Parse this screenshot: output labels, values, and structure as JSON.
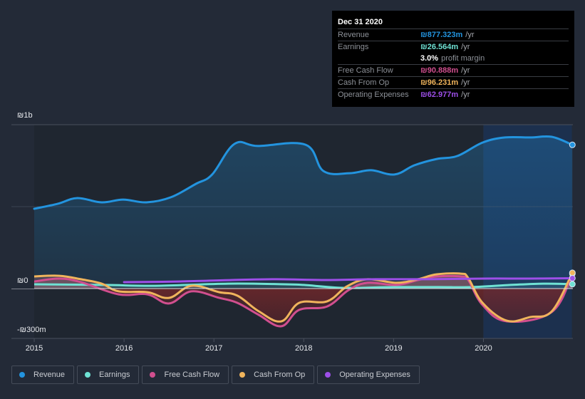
{
  "tooltip": {
    "date": "Dec 31 2020",
    "rows": [
      {
        "label": "Revenue",
        "value": "₪877.323m",
        "unit": "/yr",
        "color": "#2394df"
      },
      {
        "label": "Earnings",
        "value": "₪26.564m",
        "unit": "/yr",
        "color": "#6fe2d4"
      },
      {
        "label": "",
        "value": "3.0%",
        "unit": "profit margin",
        "color": "#ffffff"
      },
      {
        "label": "Free Cash Flow",
        "value": "₪90.888m",
        "unit": "/yr",
        "color": "#d14f8f"
      },
      {
        "label": "Cash From Op",
        "value": "₪96.231m",
        "unit": "/yr",
        "color": "#f0b45c"
      },
      {
        "label": "Operating Expenses",
        "value": "₪62.977m",
        "unit": "/yr",
        "color": "#9d4fe8"
      }
    ]
  },
  "legend": [
    {
      "label": "Revenue",
      "color": "#2394df"
    },
    {
      "label": "Earnings",
      "color": "#6fe2d4"
    },
    {
      "label": "Free Cash Flow",
      "color": "#d14f8f"
    },
    {
      "label": "Cash From Op",
      "color": "#f0b45c"
    },
    {
      "label": "Operating Expenses",
      "color": "#9d4fe8"
    }
  ],
  "chart_data": {
    "type": "line",
    "title": "",
    "xlabel": "",
    "ylabel": "",
    "currency": "₪",
    "ylim": [
      -300,
      1000
    ],
    "xlim": [
      2015.0,
      2021.0
    ],
    "y_ticks": [
      {
        "value": 1000,
        "label": "₪1b"
      },
      {
        "value": 0,
        "label": "₪0"
      },
      {
        "value": -300,
        "label": "-₪300m"
      }
    ],
    "x_ticks": [
      {
        "value": 2015,
        "label": "2015"
      },
      {
        "value": 2016,
        "label": "2016"
      },
      {
        "value": 2017,
        "label": "2017"
      },
      {
        "value": 2018,
        "label": "2018"
      },
      {
        "value": 2019,
        "label": "2019"
      },
      {
        "value": 2020,
        "label": "2020"
      }
    ],
    "forecast_shade_from": 2020.0,
    "units": "millions",
    "series": [
      {
        "name": "Revenue",
        "color": "#2394df",
        "fill": true,
        "points": [
          [
            2015.0,
            487
          ],
          [
            2015.26,
            517
          ],
          [
            2015.48,
            552
          ],
          [
            2015.75,
            526
          ],
          [
            2015.99,
            543
          ],
          [
            2016.25,
            526
          ],
          [
            2016.52,
            557
          ],
          [
            2016.8,
            639
          ],
          [
            2016.98,
            696
          ],
          [
            2017.23,
            883
          ],
          [
            2017.49,
            870
          ],
          [
            2018.02,
            878
          ],
          [
            2018.22,
            717
          ],
          [
            2018.51,
            704
          ],
          [
            2018.75,
            722
          ],
          [
            2019.01,
            696
          ],
          [
            2019.23,
            752
          ],
          [
            2019.48,
            791
          ],
          [
            2019.71,
            809
          ],
          [
            2019.99,
            891
          ],
          [
            2020.24,
            922
          ],
          [
            2020.52,
            922
          ],
          [
            2020.76,
            926
          ],
          [
            2020.99,
            877
          ]
        ]
      },
      {
        "name": "Earnings",
        "color": "#6fe2d4",
        "fill": true,
        "points": [
          [
            2015.0,
            26
          ],
          [
            2015.78,
            22
          ],
          [
            2016.35,
            17
          ],
          [
            2017.16,
            30
          ],
          [
            2017.79,
            26
          ],
          [
            2018.0,
            22
          ],
          [
            2018.46,
            4
          ],
          [
            2019.0,
            9
          ],
          [
            2019.5,
            9
          ],
          [
            2019.87,
            9
          ],
          [
            2020.3,
            22
          ],
          [
            2020.67,
            30
          ],
          [
            2020.99,
            27
          ]
        ]
      },
      {
        "name": "Free Cash Flow",
        "color": "#d14f8f",
        "fill": true,
        "points": [
          [
            2015.0,
            43
          ],
          [
            2015.28,
            61
          ],
          [
            2015.52,
            39
          ],
          [
            2015.94,
            -35
          ],
          [
            2016.26,
            -35
          ],
          [
            2016.5,
            -91
          ],
          [
            2016.75,
            -17
          ],
          [
            2017.06,
            -57
          ],
          [
            2017.26,
            -87
          ],
          [
            2017.5,
            -161
          ],
          [
            2017.75,
            -230
          ],
          [
            2017.95,
            -130
          ],
          [
            2018.26,
            -109
          ],
          [
            2018.5,
            -9
          ],
          [
            2018.71,
            35
          ],
          [
            2019.03,
            22
          ],
          [
            2019.27,
            52
          ],
          [
            2019.48,
            74
          ],
          [
            2019.75,
            74
          ],
          [
            2019.83,
            52
          ],
          [
            2019.99,
            -100
          ],
          [
            2020.26,
            -200
          ],
          [
            2020.76,
            -143
          ],
          [
            2020.99,
            91
          ]
        ]
      },
      {
        "name": "Cash From Op",
        "color": "#f0b45c",
        "fill": true,
        "points": [
          [
            2015.0,
            74
          ],
          [
            2015.28,
            78
          ],
          [
            2015.52,
            57
          ],
          [
            2015.75,
            30
          ],
          [
            2015.94,
            -17
          ],
          [
            2016.26,
            -22
          ],
          [
            2016.5,
            -57
          ],
          [
            2016.75,
            17
          ],
          [
            2017.06,
            -22
          ],
          [
            2017.26,
            -43
          ],
          [
            2017.5,
            -139
          ],
          [
            2017.75,
            -200
          ],
          [
            2017.95,
            -87
          ],
          [
            2018.26,
            -78
          ],
          [
            2018.48,
            13
          ],
          [
            2018.71,
            57
          ],
          [
            2019.03,
            35
          ],
          [
            2019.27,
            57
          ],
          [
            2019.48,
            87
          ],
          [
            2019.75,
            91
          ],
          [
            2019.83,
            65
          ],
          [
            2019.99,
            -87
          ],
          [
            2020.26,
            -196
          ],
          [
            2020.52,
            -174
          ],
          [
            2020.76,
            -139
          ],
          [
            2020.99,
            96
          ]
        ]
      },
      {
        "name": "Operating Expenses",
        "color": "#9d4fe8",
        "fill": false,
        "points": [
          [
            2016.0,
            39
          ],
          [
            2016.6,
            43
          ],
          [
            2017.2,
            52
          ],
          [
            2017.7,
            57
          ],
          [
            2018.2,
            52
          ],
          [
            2018.8,
            57
          ],
          [
            2019.4,
            57
          ],
          [
            2020.0,
            61
          ],
          [
            2020.5,
            61
          ],
          [
            2020.99,
            63
          ]
        ]
      }
    ]
  }
}
